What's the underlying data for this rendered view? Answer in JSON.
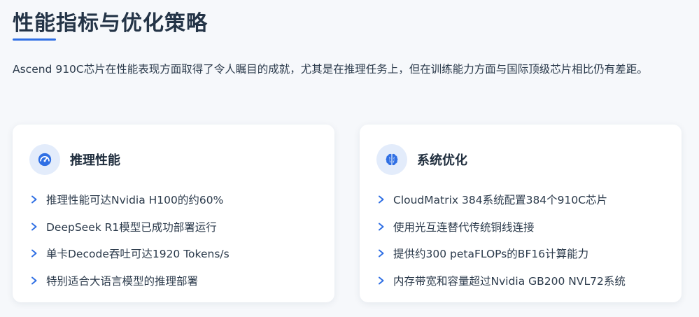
{
  "page": {
    "title": "性能指标与优化策略",
    "intro": "Ascend 910C芯片在性能表现方面取得了令人瞩目的成就，尤其是在推理任务上，但在训练能力方面与国际顶级芯片相比仍有差距。"
  },
  "colors": {
    "accent": "#2f6fe4",
    "icon_bg": "#e3ecfb",
    "text": "#2b3a4b",
    "heading": "#243447"
  },
  "cards": [
    {
      "icon": "speedometer-icon",
      "title": "推理性能",
      "items": [
        "推理性能可达Nvidia H100的约60%",
        "DeepSeek R1模型已成功部署运行",
        "单卡Decode吞吐可达1920 Tokens/s",
        "特别适合大语言模型的推理部署"
      ]
    },
    {
      "icon": "brain-icon",
      "title": "系统优化",
      "items": [
        "CloudMatrix 384系统配置384个910C芯片",
        "使用光互连替代传统铜线连接",
        "提供约300 petaFLOPs的BF16计算能力",
        "内存带宽和容量超过Nvidia GB200 NVL72系统"
      ]
    }
  ]
}
